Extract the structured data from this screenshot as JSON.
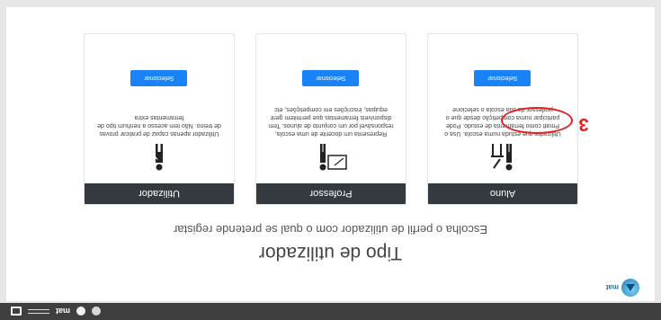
{
  "topbar": {
    "brand": "mat"
  },
  "brand": {
    "name": "mat"
  },
  "page": {
    "title": "Tipo de utilizador",
    "subtitle": "Escolha o perfil de utilizador com o qual se pretende registar"
  },
  "cards": [
    {
      "title": "Aluno",
      "description": "Utilizador que estuda numa escola. Usa o Pmatt como ferramenta de estudo. Pode participar numa competição desde que o professor da sua escola o selecione",
      "button": "Selecionar"
    },
    {
      "title": "Professor",
      "description": "Representa um docente de uma escola, responsável por um conjunto de alunos. Tem disponíveis ferramentas que permitem gerir equipas, inscrições em competições, etc",
      "button": "Selecionar"
    },
    {
      "title": "Utilizador",
      "description": "Utilizador apenas capaz de praticar provas de treino. Não tem acesso a nenhum tipo de ferramentas extra",
      "button": "Selecionar"
    }
  ],
  "annotation": {
    "number": "3",
    "color": "#e02020"
  },
  "colors": {
    "accent": "#1a82f7",
    "header": "#343a40",
    "topbar": "#3f3f3f"
  }
}
